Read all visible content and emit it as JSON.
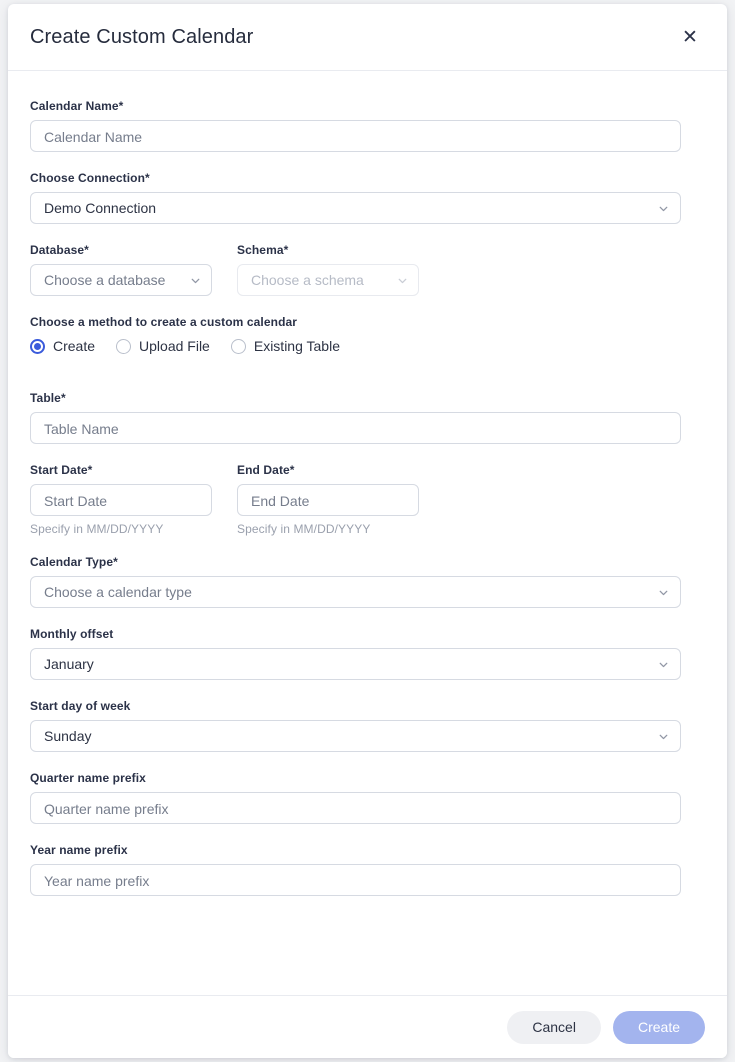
{
  "dialog": {
    "title": "Create Custom Calendar",
    "close_icon": "close-icon"
  },
  "form": {
    "calendar_name": {
      "label": "Calendar Name*",
      "placeholder": "Calendar Name",
      "value": ""
    },
    "connection": {
      "label": "Choose Connection*",
      "value": "Demo Connection"
    },
    "database": {
      "label": "Database*",
      "value": "Choose a database",
      "is_placeholder": true
    },
    "schema": {
      "label": "Schema*",
      "value": "Choose a schema",
      "is_placeholder": true,
      "disabled": true
    },
    "method": {
      "label": "Choose a method to create a custom calendar",
      "options": [
        {
          "label": "Create",
          "selected": true
        },
        {
          "label": "Upload File",
          "selected": false
        },
        {
          "label": "Existing Table",
          "selected": false
        }
      ]
    },
    "table": {
      "label": "Table*",
      "placeholder": "Table Name",
      "value": ""
    },
    "start_date": {
      "label": "Start Date*",
      "placeholder": "Start Date",
      "value": "",
      "helper": "Specify in MM/DD/YYYY"
    },
    "end_date": {
      "label": "End Date*",
      "placeholder": "End Date",
      "value": "",
      "helper": "Specify in MM/DD/YYYY"
    },
    "calendar_type": {
      "label": "Calendar Type*",
      "value": "Choose a calendar type",
      "is_placeholder": true
    },
    "monthly_offset": {
      "label": "Monthly offset",
      "value": "January"
    },
    "start_day_of_week": {
      "label": "Start day of week",
      "value": "Sunday"
    },
    "quarter_name_prefix": {
      "label": "Quarter name prefix",
      "placeholder": "Quarter name prefix",
      "value": ""
    },
    "year_name_prefix": {
      "label": "Year name prefix",
      "placeholder": "Year name prefix",
      "value": ""
    }
  },
  "footer": {
    "cancel_label": "Cancel",
    "create_label": "Create"
  },
  "colors": {
    "accent_blue": "#3b5bdb",
    "create_button": "#a3b4ee",
    "cancel_button": "#eff0f3",
    "text_primary": "#2d3344",
    "text_placeholder": "#767d8c",
    "border": "#d6dae2",
    "border_disabled": "#e8eaef"
  }
}
